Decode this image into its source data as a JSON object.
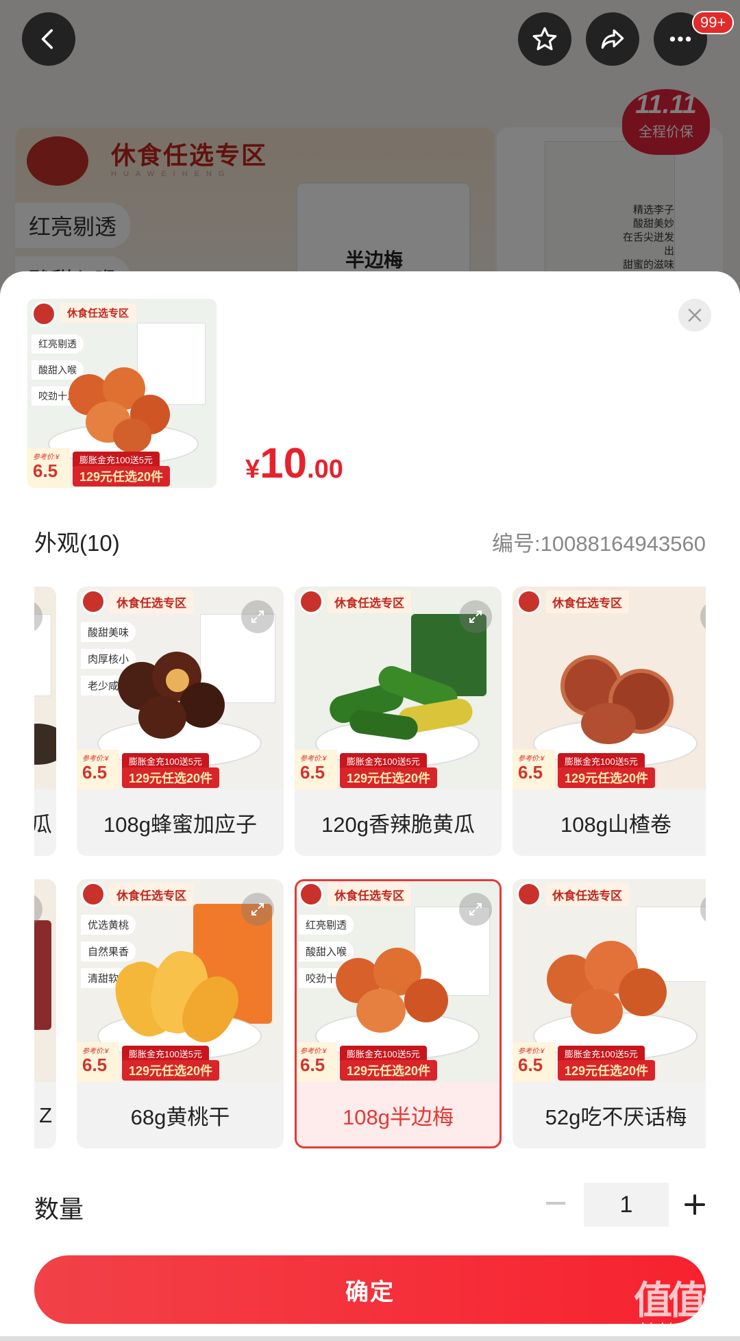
{
  "background": {
    "brand_zone": "休食任选专区",
    "brand_sub": "HUAWEIHENG",
    "chip_1": "红亮剔透",
    "chip_2": "酸甜入喉",
    "pack_title": "半边梅",
    "promo_badge_top": "11.11",
    "promo_badge_bottom": "全程价保",
    "side_copy": [
      "精选李子",
      "酸甜美妙",
      "在舌尖迸发出",
      "甜蜜的滋味"
    ]
  },
  "top_bar": {
    "back_icon": "back-arrow-icon",
    "favorite_icon": "star-icon",
    "share_icon": "share-icon",
    "more_icon": "more-icon",
    "more_badge": "99+"
  },
  "sheet": {
    "thumb": {
      "zone": "休食任选专区",
      "tags": [
        "红亮剔透",
        "酸甜入喉",
        "咬劲十足"
      ],
      "ref_label": "参考价:¥",
      "ref_price": "6.5",
      "promo_1": "膨胀金充100送5元",
      "promo_2": "129元任选20件"
    },
    "price": {
      "currency": "¥",
      "integer": "10",
      "decimal": ".00"
    },
    "section_title": "外观(10)",
    "code": "编号:10088164943560",
    "variants_row1": [
      {
        "label": "瓜",
        "partial": true,
        "zone": "",
        "tags": []
      },
      {
        "label": "108g蜂蜜加应子",
        "zone": "休食任选专区",
        "tags": [
          "酸甜美味",
          "肉厚核小",
          "老少咸宜"
        ],
        "selected": false
      },
      {
        "label": "120g香辣脆黄瓜",
        "zone": "休食任选专区",
        "tags": [],
        "selected": false
      },
      {
        "label": "108g山楂卷",
        "zone": "休食任选专区",
        "tags": [],
        "selected": false
      }
    ],
    "variants_row2": [
      {
        "label": "Z",
        "partial": true,
        "zone": "",
        "tags": []
      },
      {
        "label": "68g黄桃干",
        "zone": "休食任选专区",
        "tags": [
          "优选黄桃",
          "自然果香",
          "清甜软糯"
        ],
        "selected": false
      },
      {
        "label": "108g半边梅",
        "zone": "休食任选专区",
        "tags": [
          "红亮剔透",
          "酸甜入喉",
          "咬劲十足"
        ],
        "selected": true
      },
      {
        "label": "52g吃不厌话梅",
        "zone": "休食任选专区",
        "tags": [],
        "selected": false
      }
    ],
    "card_ref_label": "参考价:¥",
    "card_ref_price": "6.5",
    "card_promo_1": "膨胀金充100送5元",
    "card_promo_2": "129元任选20件",
    "quantity_label": "数量",
    "quantity_value": "1",
    "confirm_label": "确定"
  },
  "watermark": {
    "glyph": "值值值",
    "url": "zhizhizhi.com"
  },
  "colors": {
    "accent": "#e5232d",
    "selected_border": "#e53935"
  }
}
